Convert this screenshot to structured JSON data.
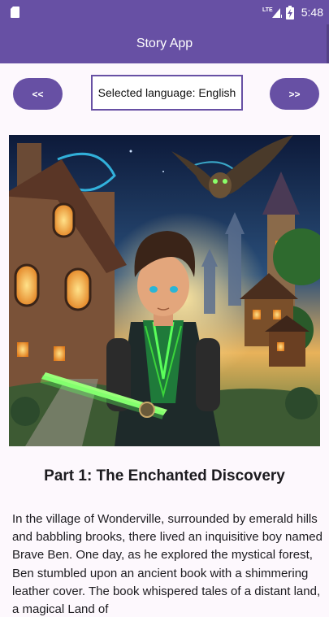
{
  "status_bar": {
    "time": "5:48",
    "left_icon": "sd-card-icon",
    "signal_label": "LTE",
    "icons": [
      "lte-signal-icon",
      "battery-charging-icon"
    ]
  },
  "app_bar": {
    "title": "Story App"
  },
  "controls": {
    "prev_label": "<<",
    "next_label": ">>",
    "language_text": "Selected language: English"
  },
  "story": {
    "illustration": "story-illustration",
    "title": "Part 1: The Enchanted Discovery",
    "body": "In the village of Wonderville, surrounded by emerald hills and babbling brooks, there lived an inquisitive boy named Brave Ben. One day, as he explored the mystical forest, Ben stumbled upon an ancient book with a shimmering leather cover. The book whispered tales of a distant land, a magical Land of"
  },
  "colors": {
    "primary": "#6750a4",
    "background": "#fdf8fd",
    "text": "#1c1b1f"
  }
}
